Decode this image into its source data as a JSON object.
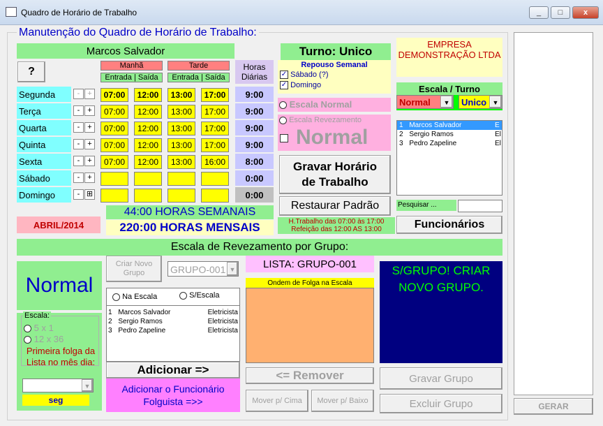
{
  "window": {
    "title": "Quadro de Horário de Trabalho",
    "min": "_",
    "max": "□",
    "close": "x"
  },
  "legend": "Manutenção do Quadro de Horário de  Trabalho:",
  "employee_name": "Marcos Salvador",
  "turno": "Turno: Unico",
  "help_button": "?",
  "manha": "Manhã",
  "tarde": "Tarde",
  "entrada_saida": "Entrada | Saída",
  "horas_diarias": "Horas Diárias",
  "days": [
    {
      "label": "Segunda",
      "t1": "07:00",
      "t2": "12:00",
      "t3": "13:00",
      "t4": "17:00",
      "hrs": "9:00"
    },
    {
      "label": "Terça",
      "t1": "07:00",
      "t2": "12:00",
      "t3": "13:00",
      "t4": "17:00",
      "hrs": "9:00"
    },
    {
      "label": "Quarta",
      "t1": "07:00",
      "t2": "12:00",
      "t3": "13:00",
      "t4": "17:00",
      "hrs": "9:00"
    },
    {
      "label": "Quinta",
      "t1": "07:00",
      "t2": "12:00",
      "t3": "13:00",
      "t4": "17:00",
      "hrs": "9:00"
    },
    {
      "label": "Sexta",
      "t1": "07:00",
      "t2": "12:00",
      "t3": "13:00",
      "t4": "16:00",
      "hrs": "8:00"
    },
    {
      "label": "Sábado",
      "t1": "",
      "t2": "",
      "t3": "",
      "t4": "",
      "hrs": "0:00"
    },
    {
      "label": "Domingo",
      "t1": "",
      "t2": "",
      "t3": "",
      "t4": "",
      "hrs": "0:00"
    }
  ],
  "minus": "-",
  "plus": "+",
  "plus_boxed": "⊞",
  "month": "ABRIL/2014",
  "weekly_hours": "44:00 HORAS SEMANAIS",
  "monthly_hours": "220:00 HORAS MENSAIS",
  "repouso": {
    "title": "Repouso Semanal",
    "sabado": "Sábado (?)",
    "domingo": "Domingo"
  },
  "escala_normal": "Escala Normal",
  "escala_revezamento": "Escala Revezamento",
  "normal_big": "Normal",
  "gravar_btn": "Gravar Horário de Trabalho",
  "restaurar_btn": "Restaurar Padrão",
  "info_trabalho": "H.Trabalho das 07:00 às 17:00",
  "info_refeicao": "Refeição das 12:00 AS 13:00",
  "empresa": "EMPRESA DEMONSTRAÇÃO LTDA",
  "escala_turno": "Escala / Turno",
  "escala_value": "Normal",
  "turno_value": "Unico",
  "employees": [
    {
      "n": "1",
      "name": "Marcos Salvador",
      "role": "E"
    },
    {
      "n": "2",
      "name": "Sergio Ramos",
      "role": "El"
    },
    {
      "n": "3",
      "name": "Pedro Zapeline",
      "role": "El"
    }
  ],
  "pesquisar": "Pesquisar ...",
  "funcionarios_btn": "Funcionários",
  "escala_grupo_title": "Escala de Revezamento por Grupo:",
  "normal_group": "Normal",
  "escala_label": "Escala:",
  "radio_5x1": "5 x 1",
  "radio_12x36": "12 x 36",
  "primeira_folga": "Primeira folga da Lista no  mês dia:",
  "day_short": "seg",
  "criar_grupo": "Criar Novo Grupo",
  "grupo_select": "GRUPO-001",
  "na_escala": "Na Escala",
  "s_escala": "S/Escala",
  "group_members": [
    {
      "n": "1",
      "name": "Marcos Salvador",
      "role": "Eletricista"
    },
    {
      "n": "2",
      "name": "Sergio Ramos",
      "role": "Eletricista"
    },
    {
      "n": "3",
      "name": "Pedro Zapeline",
      "role": "Eletricista"
    }
  ],
  "adicionar_btn": "Adicionar =>",
  "adicionar_folguista": "Adicionar o Funcionário Folguista =>>",
  "lista_grupo": "LISTA: GRUPO-001",
  "ordem_folga": "Ondem de Folga na Escala",
  "remover_btn": "<= Remover",
  "mover_cima": "Mover p/ Cima",
  "mover_baixo": "Mover p/ Baixo",
  "sgrupo_msg": "S/GRUPO! CRIAR NOVO GRUPO.",
  "gravar_grupo": "Gravar Grupo",
  "excluir_grupo": "Excluir Grupo",
  "gerar_btn": "GERAR"
}
